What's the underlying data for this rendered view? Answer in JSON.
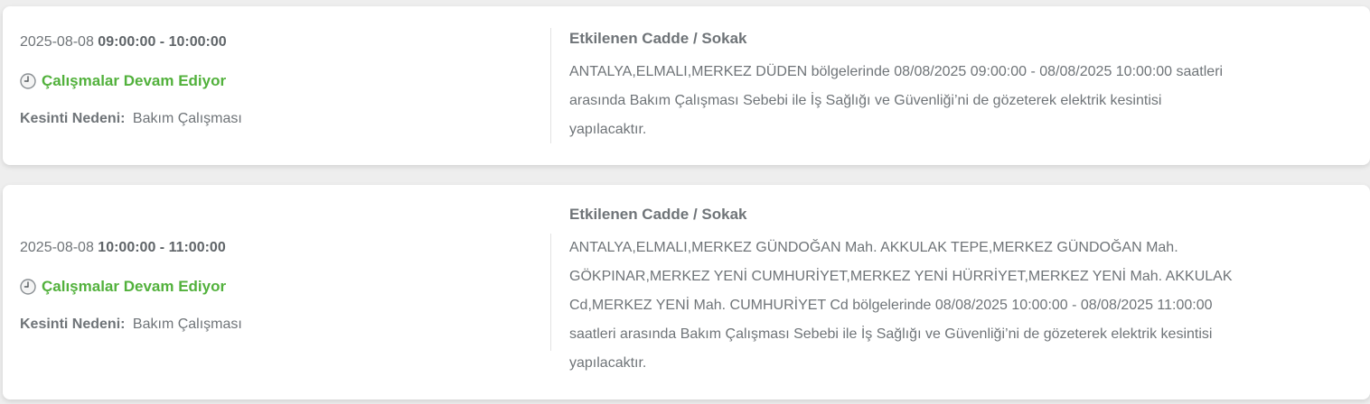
{
  "outages": [
    {
      "date": "2025-08-08",
      "time_range": "09:00:00 - 10:00:00",
      "status": "Çalışmalar Devam Ediyor",
      "reason_label": "Kesinti Nedeni:",
      "reason": "Bakım Çalışması",
      "affected_title": "Etkilenen Cadde / Sokak",
      "affected_text": "ANTALYA,ELMALI,MERKEZ DÜDEN bölgelerinde 08/08/2025 09:00:00 - 08/08/2025 10:00:00 saatleri arasında Bakım Çalışması Sebebi ile İş Sağlığı ve Güvenliği’ni de gözeterek elektrik kesintisi yapılacaktır."
    },
    {
      "date": "2025-08-08",
      "time_range": "10:00:00 - 11:00:00",
      "status": "Çalışmalar Devam Ediyor",
      "reason_label": "Kesinti Nedeni:",
      "reason": "Bakım Çalışması",
      "affected_title": "Etkilenen Cadde / Sokak",
      "affected_text": "ANTALYA,ELMALI,MERKEZ GÜNDOĞAN Mah. AKKULAK TEPE,MERKEZ GÜNDOĞAN Mah. GÖKPINAR,MERKEZ YENİ CUMHURİYET,MERKEZ YENİ HÜRRİYET,MERKEZ YENİ Mah. AKKULAK Cd,MERKEZ YENİ Mah. CUMHURİYET Cd bölgelerinde 08/08/2025 10:00:00 - 08/08/2025 11:00:00 saatleri arasında Bakım Çalışması Sebebi ile İş Sağlığı ve Güvenliği’ni de gözeterek elektrik kesintisi yapılacaktır."
    }
  ],
  "icons": {
    "status": "clock-icon"
  },
  "colors": {
    "status_green": "#52b13c",
    "text": "#6f7478",
    "card_bg": "#ffffff",
    "page_bg": "#eeeeee"
  }
}
